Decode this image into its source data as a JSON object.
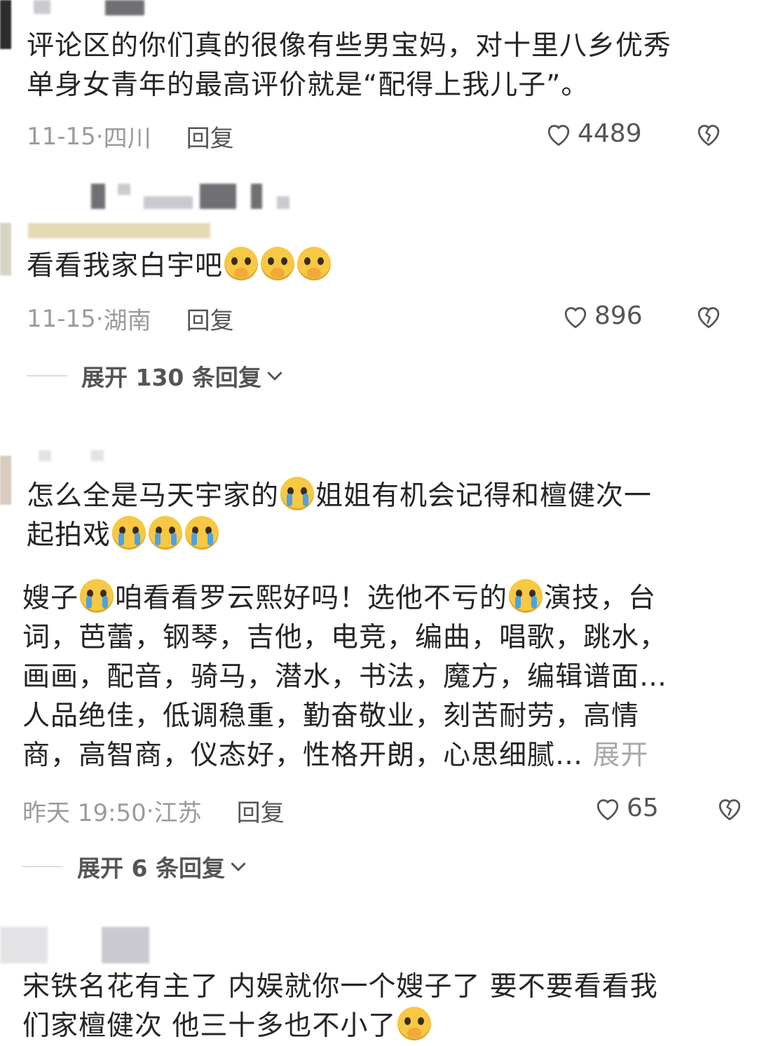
{
  "comments": [
    {
      "text": "评论区的你们真的很像有些男宝妈，对十里八乡优秀单身女青年的最高评价就是“配得上我儿子”。",
      "line1": "评论区的你们真的很像有些男宝妈，对十里八乡优秀",
      "line2": "单身女青年的最高评价就是“配得上我儿子”。",
      "date": "11-15",
      "location": "四川",
      "reply": "回复",
      "likes": "4489"
    },
    {
      "text": "看看我家白宇吧",
      "date": "11-15",
      "location": "湖南",
      "reply": "回复",
      "likes": "896",
      "expand": "展开 130 条回复"
    },
    {
      "line1a": "怎么全是马天宇家的",
      "line1b": "姐姐有机会记得和檀健次一",
      "line2": "起拍戏",
      "reply_text": {
        "l1a": "嫂子",
        "l1b": "咱看看罗云熙好吗！选他不亏的",
        "l1c": "演技，台",
        "l2": "词，芭蕾，钢琴，吉他，电竞，编曲，唱歌，跳水，",
        "l3": "画画，配音，骑马，潜水，书法，魔方，编辑谱面…",
        "l4": "人品绝佳，低调稳重，勤奋敬业，刻苦耐劳，高情",
        "l5": "商，高智商，仪态好，性格开朗，心思细腻…",
        "more": "展开"
      },
      "date": "昨天 19:50",
      "location": "江苏",
      "reply": "回复",
      "likes": "65",
      "expand": "展开 6 条回复"
    },
    {
      "line1": "宋铁名花有主了 内娱就你一个嫂子了 要不要看看我",
      "line2": "们家檀健次 他三十多也不小了"
    }
  ],
  "icons": {
    "like": "heart-outline-icon",
    "dislike": "broken-heart-icon",
    "expand": "chevron-down-icon",
    "emoji_plead": "pleading-face-emoji",
    "emoji_cry": "loudly-crying-face-emoji"
  },
  "colors": {
    "text": "#252525",
    "meta": "#9b9b9b",
    "accent": "#555555"
  }
}
